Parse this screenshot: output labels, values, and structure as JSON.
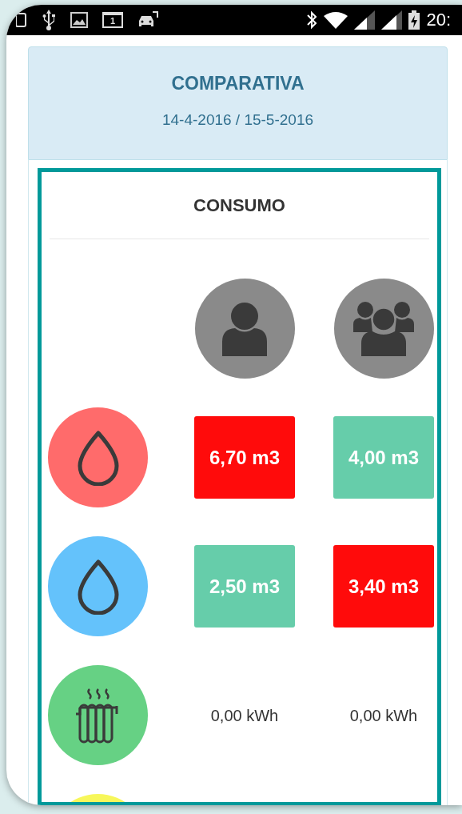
{
  "status_bar": {
    "calendar_day": "1",
    "time": "20:"
  },
  "header": {
    "title": "COMPARATIVA",
    "dates": "14-4-2016 / 15-5-2016"
  },
  "section": {
    "title": "CONSUMO",
    "columns": [
      {
        "kind": "person"
      },
      {
        "kind": "group"
      }
    ],
    "rows": [
      {
        "kind": "water",
        "color": "#ff6b6b",
        "cells": [
          {
            "kind": "badge",
            "over": true,
            "value": "6,70 m3"
          },
          {
            "kind": "badge",
            "over": false,
            "value": "4,00 m3"
          }
        ]
      },
      {
        "kind": "water",
        "color": "#64c2fb",
        "cells": [
          {
            "kind": "badge",
            "over": false,
            "value": "2,50 m3"
          },
          {
            "kind": "badge",
            "over": true,
            "value": "3,40 m3"
          }
        ]
      },
      {
        "kind": "heating",
        "color": "#66d184",
        "cells": [
          {
            "kind": "plain",
            "value": "0,00 kWh"
          },
          {
            "kind": "plain",
            "value": "0,00 kWh"
          }
        ]
      },
      {
        "kind": "other",
        "color": "#f7f75a",
        "cells": []
      }
    ]
  }
}
